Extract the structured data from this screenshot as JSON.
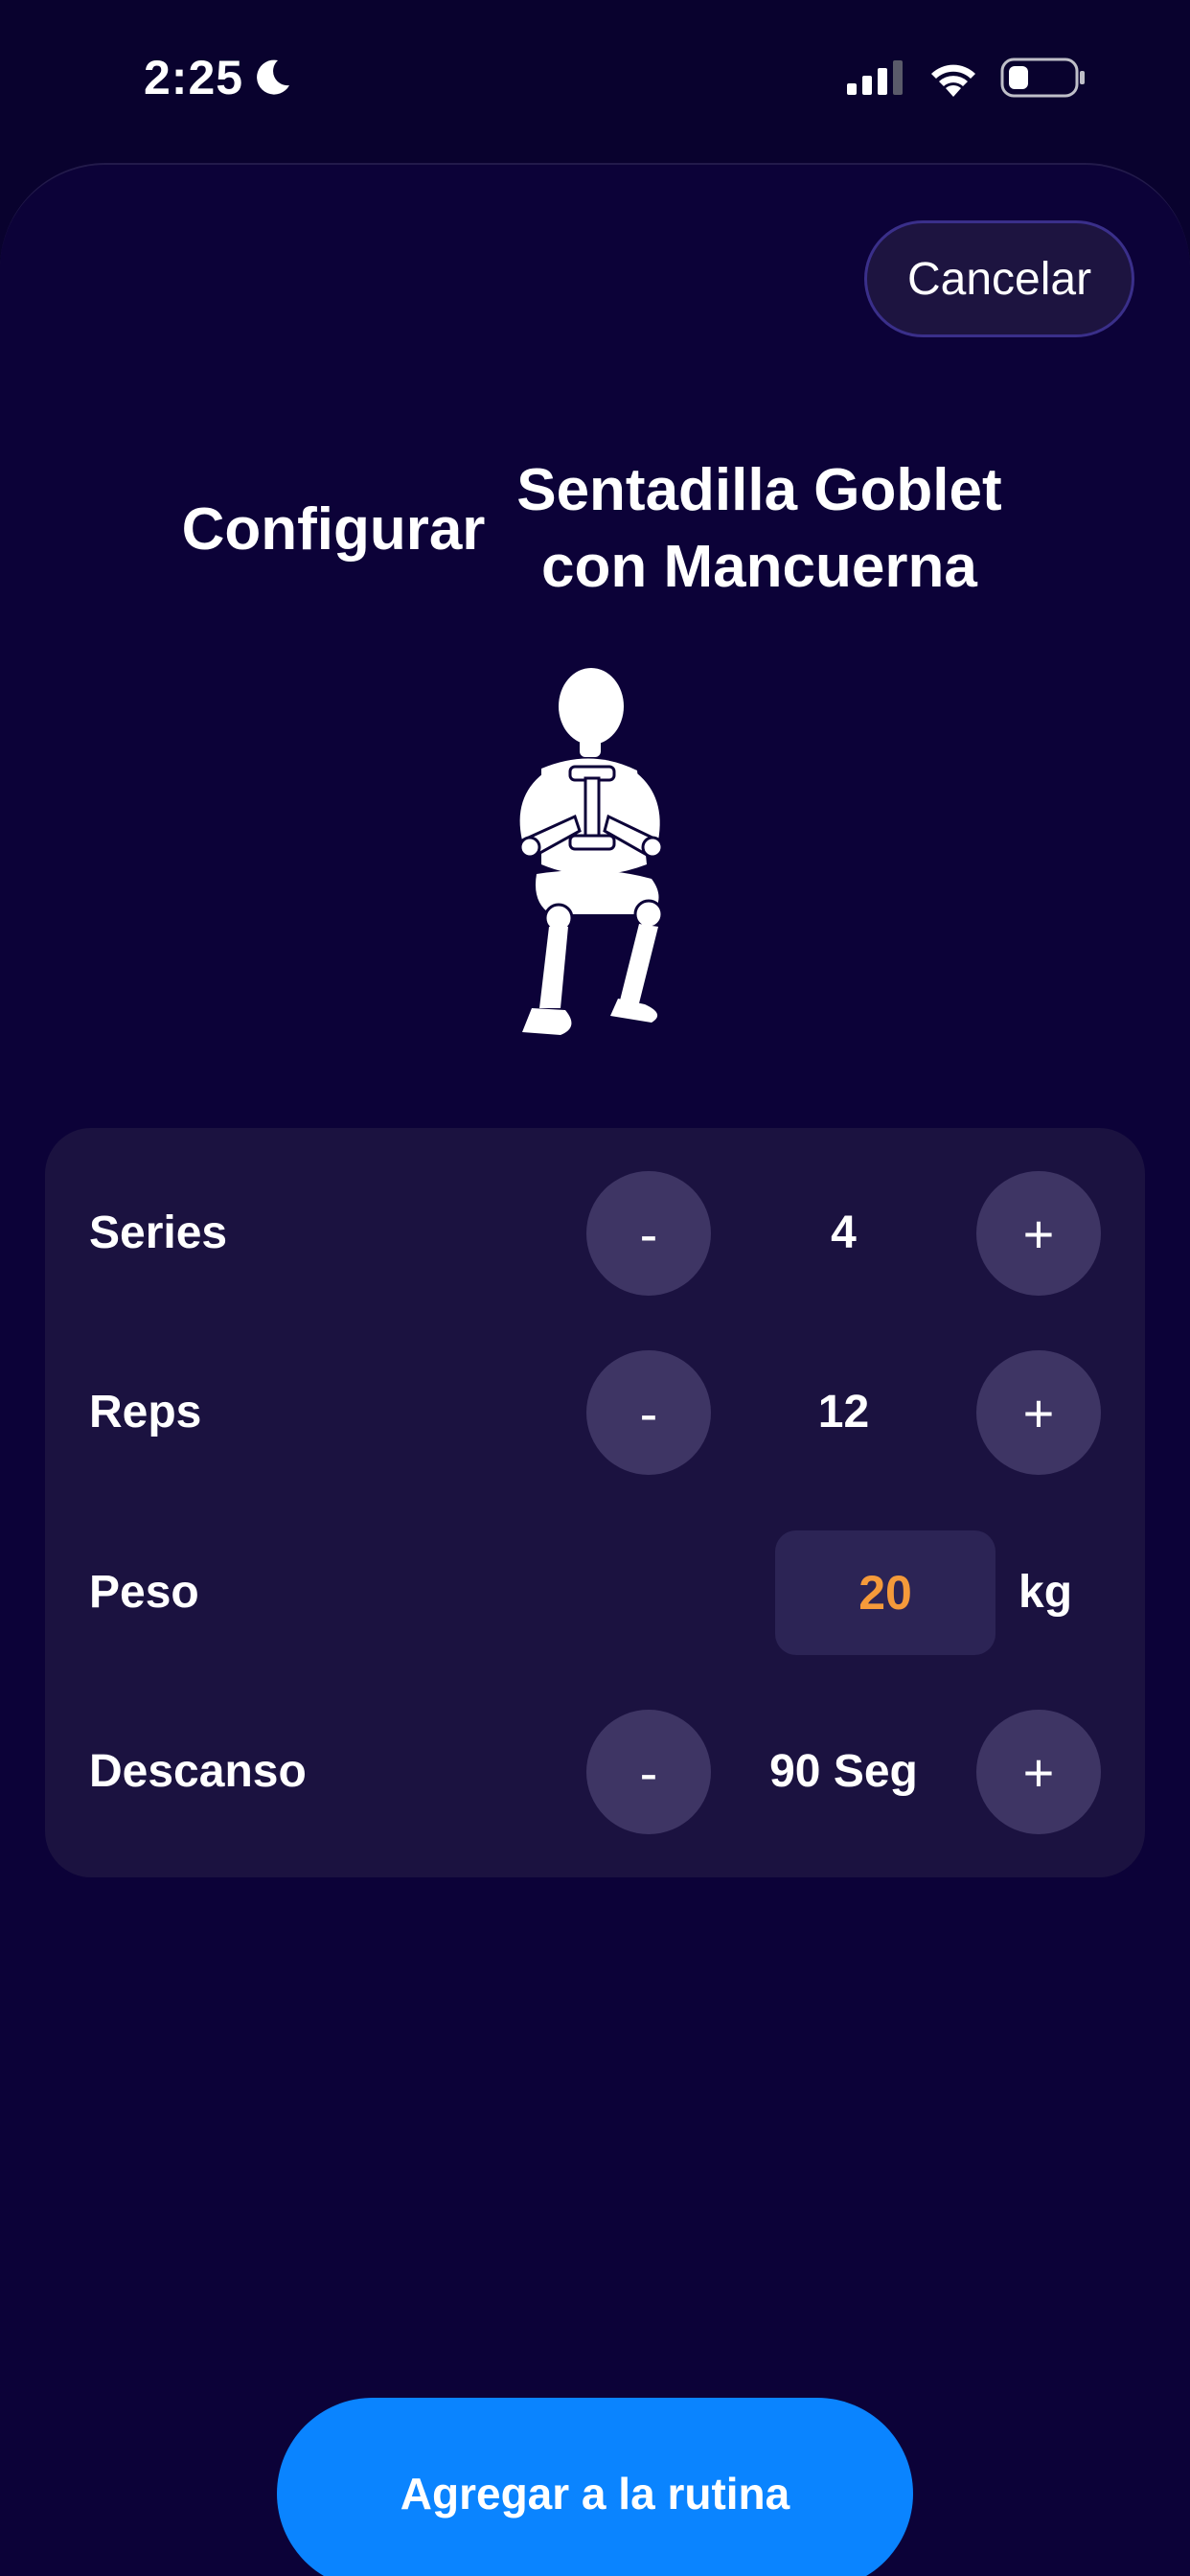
{
  "status_bar": {
    "time": "2:25",
    "icons": [
      "moon-icon",
      "signal-icon",
      "wifi-icon",
      "battery-icon"
    ]
  },
  "header": {
    "cancel_label": "Cancelar",
    "title_prefix": "Configurar",
    "exercise_name": "Sentadilla Goblet con Mancuerna"
  },
  "config": {
    "series": {
      "label": "Series",
      "value": "4",
      "minus": "-",
      "plus": "+"
    },
    "reps": {
      "label": "Reps",
      "value": "12",
      "minus": "-",
      "plus": "+"
    },
    "weight": {
      "label": "Peso",
      "value": "20",
      "unit": "kg"
    },
    "rest": {
      "label": "Descanso",
      "value": "90 Seg",
      "minus": "-",
      "plus": "+"
    }
  },
  "footer": {
    "add_label": "Agregar a la rutina"
  },
  "colors": {
    "background": "#09022e",
    "card": "#1b1240",
    "stepper": "#3e3564",
    "accent": "#0a84ff",
    "weight_value": "#f59a3a"
  }
}
